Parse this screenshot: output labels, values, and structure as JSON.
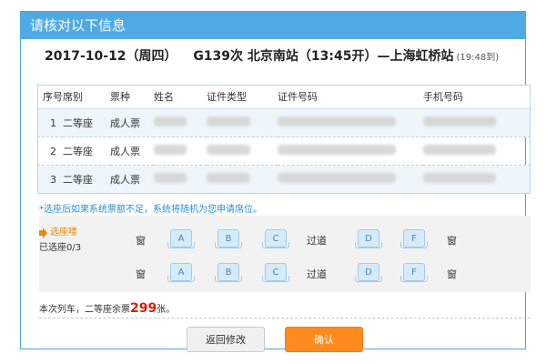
{
  "dialog": {
    "title": "请核对以下信息",
    "trip": {
      "date": "2017-10-12（周四）",
      "train": "G139次",
      "from": "北京南站（13:45开）",
      "sep": "—",
      "to": "上海虹桥站",
      "arrive": "(19:48到)"
    },
    "table": {
      "headers": [
        "序号",
        "席别",
        "票种",
        "姓名",
        "证件类型",
        "证件号码",
        "手机号码"
      ],
      "rows": [
        {
          "no": "1",
          "seat_class": "二等座",
          "ticket_type": "成人票"
        },
        {
          "no": "2",
          "seat_class": "二等座",
          "ticket_type": "成人票"
        },
        {
          "no": "3",
          "seat_class": "二等座",
          "ticket_type": "成人票"
        }
      ]
    },
    "note": "*选座后如果系统票额不足，系统将随机为您申请席位。",
    "seat_selector": {
      "title": "选座喽",
      "count": "已选座0/3",
      "window": "窗",
      "aisle": "过道",
      "left_seats": [
        "A",
        "B",
        "C"
      ],
      "right_seats": [
        "D",
        "F"
      ]
    },
    "remaining": {
      "prefix": "本次列车，二等座余票",
      "count": "299",
      "suffix": "张。"
    },
    "buttons": {
      "back": "返回修改",
      "confirm": "确认"
    }
  }
}
